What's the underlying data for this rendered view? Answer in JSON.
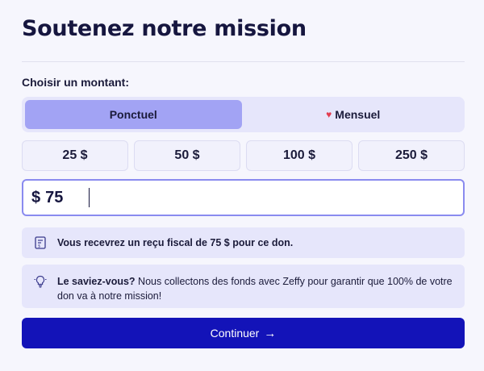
{
  "header": {
    "title": "Soutenez notre mission"
  },
  "amount_section": {
    "label": "Choisir un montant:"
  },
  "frequency": {
    "options": [
      {
        "label": "Ponctuel",
        "selected": true
      },
      {
        "label": "Mensuel",
        "selected": false,
        "icon": "heart-icon"
      }
    ],
    "colors": {
      "selected_bg": "#a2a3f4",
      "heart": "#e23c50"
    }
  },
  "preset_amounts": [
    "25 $",
    "50 $",
    "100 $",
    "250 $"
  ],
  "custom_amount": {
    "currency_symbol": "$",
    "value": "75"
  },
  "receipt_info": {
    "icon": "receipt-icon",
    "text": "Vous recevrez un reçu fiscal de 75 $ pour ce don."
  },
  "tip": {
    "icon": "lightbulb-icon",
    "bold_lead": "Le saviez-vous?",
    "text": " Nous collectons des fonds avec Zeffy pour garantir que 100% de votre don va à notre mission!"
  },
  "continue_button": {
    "label": "Continuer",
    "arrow": "→",
    "color": "#1313b8"
  }
}
